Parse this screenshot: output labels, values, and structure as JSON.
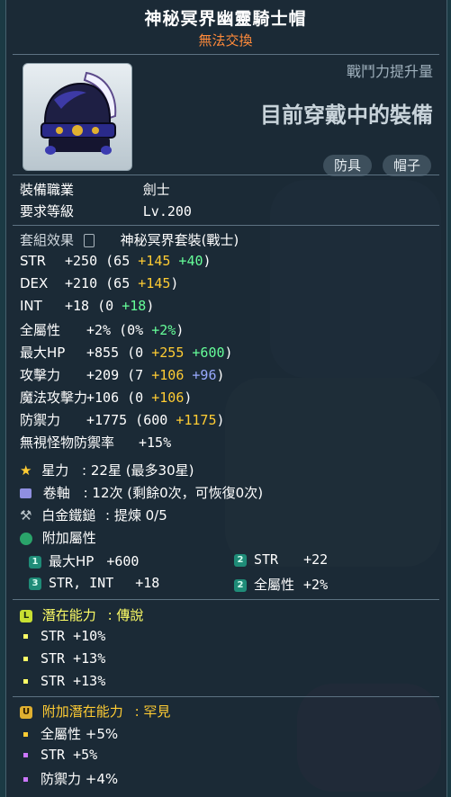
{
  "header": {
    "title": "神秘冥界幽靈騎士帽",
    "subtitle": "無法交換"
  },
  "item": {
    "power_label": "戰鬥力提升量",
    "equipped_text": "目前穿戴中的裝備",
    "tags": [
      "防具",
      "帽子"
    ]
  },
  "requirements": {
    "job_label": "裝備職業",
    "job_value": "劍士",
    "level_label": "要求等級",
    "level_value": "Lv.200"
  },
  "set": {
    "label": "套組效果",
    "value": "神秘冥界套裝(戰士)"
  },
  "stats": [
    {
      "label": "STR",
      "base": "+250 (65 ",
      "a": "+145",
      "b": " +40",
      "tail": ")"
    },
    {
      "label": "DEX",
      "base": "+210 (65 ",
      "a": "+145",
      "b": "",
      "tail": ")"
    },
    {
      "label": "INT",
      "base": "+18 (0 ",
      "a": "",
      "b": "+18",
      "tail": ")"
    },
    {
      "label": "全屬性",
      "base": "+2% (0% ",
      "a": "",
      "b": "+2%",
      "tail": ")"
    },
    {
      "label": "最大HP",
      "base": "+855 (0 ",
      "a": "+255",
      "b": " +600",
      "tail": ")"
    },
    {
      "label": "攻擊力",
      "base": "+209 (7 ",
      "a": "+106",
      "c": " +96",
      "tail": ")"
    },
    {
      "label": "魔法攻擊力",
      "base": "+106 (0 ",
      "a": "+106",
      "b": "",
      "tail": ")"
    },
    {
      "label": "防禦力",
      "base": "+1775 (600 ",
      "a": "+1175",
      "b": "",
      "tail": ")"
    },
    {
      "label": "無視怪物防禦率",
      "base": "+15%",
      "a": "",
      "b": "",
      "tail": ""
    }
  ],
  "star": {
    "label": "星力",
    "value": ": 22星 (最多30星)"
  },
  "scroll": {
    "label": "卷軸",
    "value": ": 12次 (剩餘0次，可恢復0次)"
  },
  "hammer": {
    "label": "白金鐵鎚",
    "value": ": 提煉 0/5"
  },
  "bonus": {
    "label": "附加屬性",
    "items": [
      {
        "badge": "1",
        "text": "最大HP",
        "value": "+600"
      },
      {
        "badge": "2",
        "text": "STR",
        "value": "+22"
      },
      {
        "badge": "3",
        "text": "STR, INT",
        "value": "+18"
      },
      {
        "badge": "2",
        "text": "全屬性",
        "value": "+2%"
      }
    ]
  },
  "potential": {
    "label": "潛在能力",
    "grade": ": 傳說",
    "lines": [
      "STR +10%",
      "STR +13%",
      "STR +13%"
    ]
  },
  "additional_potential": {
    "label": "附加潛在能力",
    "grade": ": 罕見",
    "lines": [
      "全屬性 +5%",
      "STR +5%",
      "防禦力 +4%"
    ]
  },
  "colors": {
    "legendary": "#ffff66",
    "rare": "#ffcc33",
    "untradable": "#ff8a3a",
    "bonus_green": "#66ff99",
    "star_gold": "#ffcc33",
    "enhance_blue": "#99aaff"
  }
}
